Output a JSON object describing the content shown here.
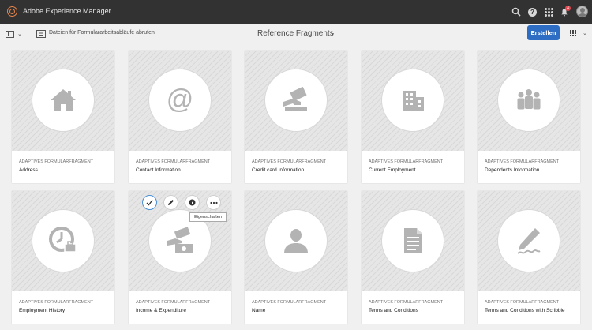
{
  "app": {
    "title": "Adobe Experience Manager",
    "notification_count": "4"
  },
  "toolbar": {
    "action_label": "Dateien für Formulararbeitsabläufe abrufen",
    "page_title": "Reference Fragments",
    "create_label": "Erstellen"
  },
  "tooltip": {
    "text": "Eigenschaften"
  },
  "cards": [
    {
      "type": "ADAPTIVES FORMULARFRAGMENT",
      "title": "Address",
      "icon": "house-icon"
    },
    {
      "type": "ADAPTIVES FORMULARFRAGMENT",
      "title": "Contact Information",
      "icon": "at-sign-icon"
    },
    {
      "type": "ADAPTIVES FORMULARFRAGMENT",
      "title": "Credit card Information",
      "icon": "credit-card-hand-icon"
    },
    {
      "type": "ADAPTIVES FORMULARFRAGMENT",
      "title": "Current Employment",
      "icon": "building-icon"
    },
    {
      "type": "ADAPTIVES FORMULARFRAGMENT",
      "title": "Dependents Information",
      "icon": "people-group-icon"
    },
    {
      "type": "ADAPTIVES FORMULARFRAGMENT",
      "title": "Employment History",
      "icon": "clock-briefcase-icon"
    },
    {
      "type": "ADAPTIVES FORMULARFRAGMENT",
      "title": "Income & Expenditure",
      "icon": "money-icon"
    },
    {
      "type": "ADAPTIVES FORMULARFRAGMENT",
      "title": "Name",
      "icon": "person-icon"
    },
    {
      "type": "ADAPTIVES FORMULARFRAGMENT",
      "title": "Terms and Conditions",
      "icon": "document-icon"
    },
    {
      "type": "ADAPTIVES FORMULARFRAGMENT",
      "title": "Terms and Conditions with Scribble",
      "icon": "pen-scribble-icon"
    }
  ],
  "colors": {
    "topbar": "#323232",
    "accent": "#2d6ec4",
    "icon_gray": "#b3b3b3"
  }
}
